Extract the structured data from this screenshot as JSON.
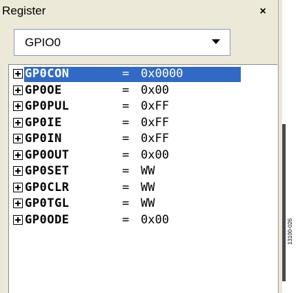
{
  "window": {
    "title": "Register",
    "close_label": "×"
  },
  "dropdown": {
    "selected": "GPIO0"
  },
  "registers": [
    {
      "name": "GP0CON",
      "eq": "=",
      "value": "0x0000",
      "selected": true
    },
    {
      "name": "GP0OE",
      "eq": "=",
      "value": "0x00",
      "selected": false
    },
    {
      "name": "GP0PUL",
      "eq": "=",
      "value": "0xFF",
      "selected": false
    },
    {
      "name": "GP0IE",
      "eq": "=",
      "value": "0xFF",
      "selected": false
    },
    {
      "name": "GP0IN",
      "eq": "=",
      "value": "0xFF",
      "selected": false
    },
    {
      "name": "GP0OUT",
      "eq": "=",
      "value": "0x00",
      "selected": false
    },
    {
      "name": "GP0SET",
      "eq": "=",
      "value": "WW",
      "selected": false
    },
    {
      "name": "GP0CLR",
      "eq": "=",
      "value": "WW",
      "selected": false
    },
    {
      "name": "GP0TGL",
      "eq": "=",
      "value": "WW",
      "selected": false
    },
    {
      "name": "GP0ODE",
      "eq": "=",
      "value": "0x00",
      "selected": false
    }
  ],
  "side_code": "13100-026",
  "colors": {
    "selection": "#316ac5",
    "panel_bg": "#ece9d8"
  },
  "icons": {
    "close": "close-icon",
    "dropdown": "chevron-down-icon",
    "expander": "plus-box-icon"
  }
}
